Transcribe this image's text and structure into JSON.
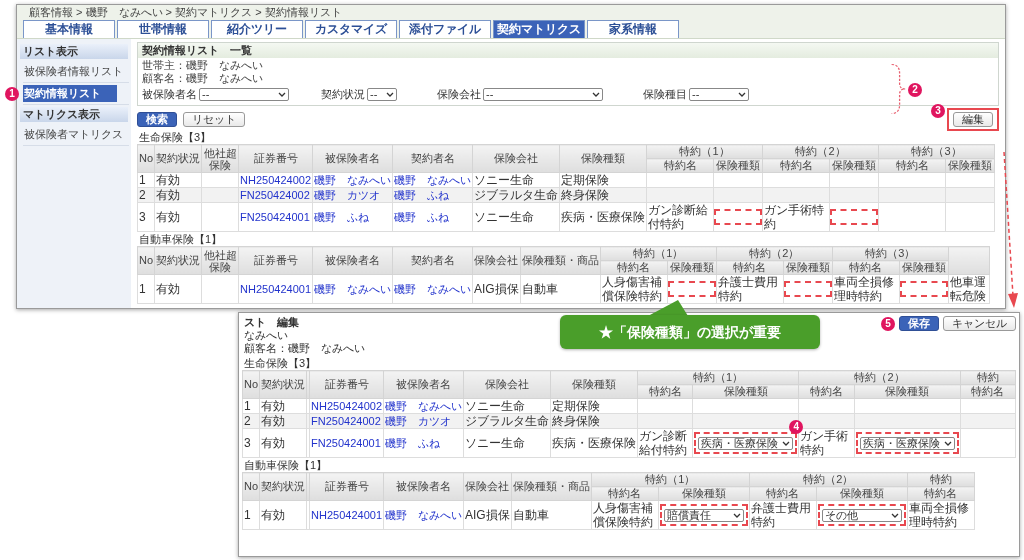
{
  "window1": {
    "breadcrumb": "顧客情報 > 磯野　なみへい > 契約マトリクス > 契約情報リスト",
    "tabs": [
      {
        "label": "基本情報",
        "selected": false
      },
      {
        "label": "世帯情報",
        "selected": false
      },
      {
        "label": "紹介ツリー",
        "selected": false
      },
      {
        "label": "カスタマイズ",
        "selected": false
      },
      {
        "label": "添付ファイル",
        "selected": false
      },
      {
        "label": "契約マトリクス",
        "selected": true
      },
      {
        "label": "家系情報",
        "selected": false
      }
    ],
    "sidebar": [
      {
        "title": "リスト表示",
        "items": [
          {
            "label": "被保険者情報リスト",
            "selected": false
          },
          {
            "label": "契約情報リスト",
            "selected": true,
            "marker": "1"
          }
        ]
      },
      {
        "title": "マトリクス表示",
        "items": [
          {
            "label": "被保険者マトリクス",
            "selected": false
          }
        ]
      }
    ],
    "panel": {
      "title": "契約情報リスト　一覧",
      "household_head": "世帯主：磯野　なみへい",
      "customer": "顧客名：磯野　なみへい",
      "marker": "2",
      "filters": [
        [
          {
            "label": "被保険者名",
            "value": "--"
          }
        ],
        [
          {
            "label": "契約状況",
            "value": "--"
          },
          {
            "label": "保険会社",
            "value": "--"
          },
          {
            "label": "保険種目",
            "value": "--"
          }
        ]
      ]
    },
    "search_button": "検索",
    "reset_button": "リセット",
    "edit_button": {
      "label": "編集",
      "marker": "3"
    },
    "tables": [
      {
        "caption": "生命保険【3】",
        "columns": [
          {
            "kind": "label",
            "label": "No"
          },
          {
            "kind": "label",
            "label": "契約状況"
          },
          {
            "kind": "label",
            "label": "他社超保険"
          },
          {
            "kind": "label",
            "label": "証券番号"
          },
          {
            "kind": "label",
            "label": "被保険者名"
          },
          {
            "kind": "label",
            "label": "契約者名"
          },
          {
            "kind": "label",
            "label": "保険会社"
          },
          {
            "kind": "label",
            "label": "保険種類"
          }
        ],
        "rider_groups": [
          {
            "label": "特約（1）",
            "columns": [
              "特約名",
              "保険種類"
            ]
          },
          {
            "label": "特約（2）",
            "columns": [
              "特約名",
              "保険種類"
            ]
          },
          {
            "label": "特約（3）",
            "columns": [
              "特約名",
              "保険種類"
            ]
          }
        ],
        "rows": [
          {
            "cells": [
              {
                "kind": "text",
                "text": "1"
              },
              {
                "kind": "text",
                "text": "有効"
              },
              {
                "kind": "blank"
              },
              {
                "kind": "link",
                "text": "NH250424002"
              },
              {
                "kind": "link",
                "text": "磯野　なみへい"
              },
              {
                "kind": "link",
                "text": "磯野　なみへい"
              },
              {
                "kind": "text",
                "text": "ソニー生命"
              },
              {
                "kind": "text",
                "text": "定期保険"
              }
            ],
            "riders": [
              {
                "highlighted": false
              },
              {
                "highlighted": false
              },
              {
                "highlighted": false
              }
            ]
          },
          {
            "cells": [
              {
                "kind": "text",
                "text": "2"
              },
              {
                "kind": "text",
                "text": "有効"
              },
              {
                "kind": "blank"
              },
              {
                "kind": "link",
                "text": "FN250424002"
              },
              {
                "kind": "link",
                "text": "磯野　カツオ"
              },
              {
                "kind": "link",
                "text": "磯野　ふね"
              },
              {
                "kind": "text",
                "text": "ジブラルタ生命"
              },
              {
                "kind": "text",
                "text": "終身保険"
              }
            ],
            "riders": [
              {
                "highlighted": false
              },
              {
                "highlighted": false
              },
              {
                "highlighted": false
              }
            ]
          },
          {
            "cells": [
              {
                "kind": "text",
                "text": "3"
              },
              {
                "kind": "text",
                "text": "有効"
              },
              {
                "kind": "blank"
              },
              {
                "kind": "link",
                "text": "FN250424001"
              },
              {
                "kind": "link",
                "text": "磯野　ふね"
              },
              {
                "kind": "link",
                "text": "磯野　ふね"
              },
              {
                "kind": "text",
                "text": "ソニー生命"
              },
              {
                "kind": "text",
                "text": "疾病・医療保険"
              }
            ],
            "riders": [
              {
                "name": "ガン診断給付特約",
                "highlighted": true
              },
              {
                "name": "ガン手術特約",
                "highlighted": true
              },
              {
                "highlighted": false
              }
            ]
          }
        ]
      },
      {
        "caption": "自動車保険【1】",
        "columns": [
          {
            "kind": "label",
            "label": "No"
          },
          {
            "kind": "label",
            "label": "契約状況"
          },
          {
            "kind": "label",
            "label": "他社超保険"
          },
          {
            "kind": "label",
            "label": "証券番号"
          },
          {
            "kind": "label",
            "label": "被保険者名"
          },
          {
            "kind": "label",
            "label": "契約者名"
          },
          {
            "kind": "label",
            "label": "保険会社"
          },
          {
            "kind": "label",
            "label": "保険種類・商品"
          }
        ],
        "rider_groups": [
          {
            "label": "特約（1）",
            "columns": [
              "特約名",
              "保険種類"
            ]
          },
          {
            "label": "特約（2）",
            "columns": [
              "特約名",
              "保険種類"
            ]
          },
          {
            "label": "特約（3）",
            "columns": [
              "特約名",
              "保険種類"
            ]
          }
        ],
        "rows": [
          {
            "cells": [
              {
                "kind": "text",
                "text": "1"
              },
              {
                "kind": "text",
                "text": "有効"
              },
              {
                "kind": "blank"
              },
              {
                "kind": "link",
                "text": "NH250424001"
              },
              {
                "kind": "link",
                "text": "磯野　なみへい"
              },
              {
                "kind": "link",
                "text": "磯野　なみへい"
              },
              {
                "kind": "text",
                "text": "AIG損保"
              },
              {
                "kind": "text",
                "text": "自動車"
              }
            ],
            "riders": [
              {
                "name": "人身傷害補償保険特約",
                "highlighted": true
              },
              {
                "name": "弁護士費用特約",
                "highlighted": true
              },
              {
                "name": "車両全損修理時特約",
                "highlighted": true
              },
              {
                "name": "他車運転危険",
                "highlighted": false
              }
            ]
          }
        ]
      }
    ]
  },
  "window2": {
    "title": "スト　編集",
    "household_head": "なみへい",
    "customer": "顧客名：磯野　なみへい",
    "save_button": {
      "label": "保存",
      "marker": "5"
    },
    "cancel_button": "キャンセル",
    "tables": [
      {
        "caption": "生命保険【3】",
        "columns": [
          {
            "kind": "label",
            "label": "No"
          },
          {
            "kind": "label",
            "label": "契約状況"
          },
          {
            "kind": "blank"
          },
          {
            "kind": "label",
            "label": "証券番号"
          },
          {
            "kind": "label",
            "label": "被保険者名"
          },
          {
            "kind": "label",
            "label": "保険会社"
          },
          {
            "kind": "label",
            "label": "保険種類"
          }
        ],
        "rider_groups": [
          {
            "label": "特約（1）",
            "columns": [
              "特約名",
              "保険種類"
            ]
          },
          {
            "label": "特約（2）",
            "columns": [
              "特約名",
              "保険種類"
            ]
          },
          {
            "label": "特約",
            "columns": [
              "特約名"
            ]
          }
        ],
        "rows": [
          {
            "cells": [
              {
                "kind": "text",
                "text": "1"
              },
              {
                "kind": "text",
                "text": "有効"
              },
              {
                "kind": "blank"
              },
              {
                "kind": "link",
                "text": "NH250424002"
              },
              {
                "kind": "link",
                "text": "磯野　なみへい"
              },
              {
                "kind": "text",
                "text": "ソニー生命"
              },
              {
                "kind": "text",
                "text": "定期保険"
              }
            ],
            "riders": [
              {
                "highlighted": false
              },
              {
                "highlighted": false
              },
              {
                "highlighted": false
              }
            ]
          },
          {
            "cells": [
              {
                "kind": "text",
                "text": "2"
              },
              {
                "kind": "text",
                "text": "有効"
              },
              {
                "kind": "blank"
              },
              {
                "kind": "link",
                "text": "FN250424002"
              },
              {
                "kind": "link",
                "text": "磯野　カツオ"
              },
              {
                "kind": "text",
                "text": "ジブラルタ生命"
              },
              {
                "kind": "text",
                "text": "終身保険"
              }
            ],
            "riders": [
              {
                "highlighted": false
              },
              {
                "highlighted": false
              },
              {
                "highlighted": false
              }
            ]
          },
          {
            "cells": [
              {
                "kind": "text",
                "text": "3"
              },
              {
                "kind": "text",
                "text": "有効"
              },
              {
                "kind": "blank"
              },
              {
                "kind": "link",
                "text": "FN250424001"
              },
              {
                "kind": "link",
                "text": "磯野　ふね"
              },
              {
                "kind": "text",
                "text": "ソニー生命"
              },
              {
                "kind": "text",
                "text": "疾病・医療保険"
              }
            ],
            "riders": [
              {
                "name": "ガン診断給付特約",
                "select": "疾病・医療保険",
                "highlighted": true,
                "marker": "4"
              },
              {
                "name": "ガン手術特約",
                "select": "疾病・医療保険",
                "highlighted": true
              },
              {
                "highlighted": false
              }
            ]
          }
        ]
      },
      {
        "caption": "自動車保険【1】",
        "columns": [
          {
            "kind": "label",
            "label": "No"
          },
          {
            "kind": "label",
            "label": "契約状況"
          },
          {
            "kind": "blank"
          },
          {
            "kind": "label",
            "label": "証券番号"
          },
          {
            "kind": "label",
            "label": "被保険者名"
          },
          {
            "kind": "label",
            "label": "保険会社"
          },
          {
            "kind": "label",
            "label": "保険種類・商品"
          }
        ],
        "rider_groups": [
          {
            "label": "特約（1）",
            "columns": [
              "特約名",
              "保険種類"
            ]
          },
          {
            "label": "特約（2）",
            "columns": [
              "特約名",
              "保険種類"
            ]
          },
          {
            "label": "特約",
            "columns": [
              "特約名"
            ]
          }
        ],
        "rows": [
          {
            "cells": [
              {
                "kind": "text",
                "text": "1"
              },
              {
                "kind": "text",
                "text": "有効"
              },
              {
                "kind": "blank"
              },
              {
                "kind": "link",
                "text": "NH250424001"
              },
              {
                "kind": "link",
                "text": "磯野　なみへい"
              },
              {
                "kind": "text",
                "text": "AIG損保"
              },
              {
                "kind": "text",
                "text": "自動車"
              }
            ],
            "riders": [
              {
                "name": "人身傷害補償保険特約",
                "select": "賠償責任",
                "highlighted": true
              },
              {
                "name": "弁護士費用特約",
                "select": "その他",
                "highlighted": true
              },
              {
                "name": "車両全損修理時特約",
                "highlighted": false
              }
            ]
          }
        ]
      }
    ]
  },
  "callout": {
    "text": "★「保険種類」の選択が重要"
  }
}
